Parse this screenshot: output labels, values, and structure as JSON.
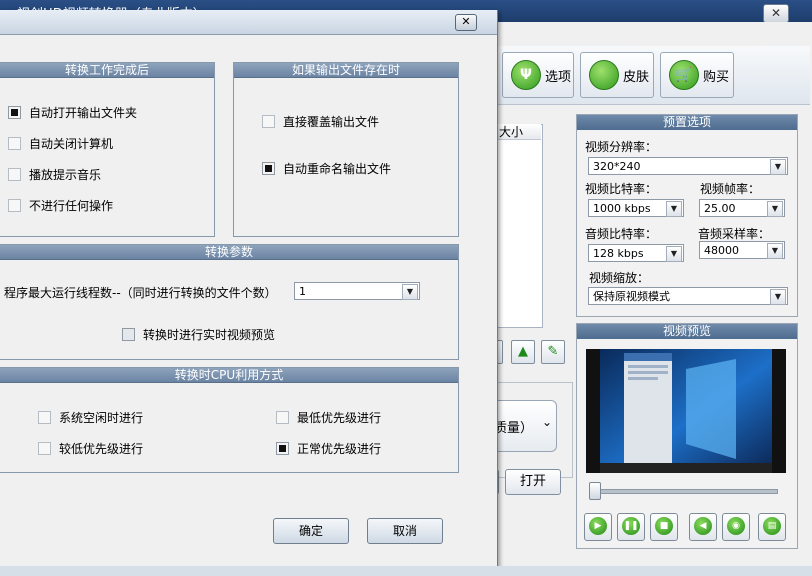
{
  "main_window": {
    "title": "—视创HD视频转换器（专业版本）"
  },
  "toolbar": {
    "options_label": "选项",
    "skin_label": "皮肤",
    "buy_label": "购买"
  },
  "file_list": {
    "size_header": "大小"
  },
  "quality": {
    "partial_text": "质量）",
    "open_label": "打开"
  },
  "preset": {
    "title": "预置选项",
    "resolution_label": "视频分辨率：",
    "resolution_value": "320*240",
    "video_bitrate_label": "视频比特率：",
    "video_bitrate_value": "1000 kbps",
    "framerate_label": "视频帧率：",
    "framerate_value": "25.00",
    "audio_bitrate_label": "音频比特率：",
    "audio_bitrate_value": "128 kbps",
    "samplerate_label": "音频采样率：",
    "samplerate_value": "48000",
    "scale_label": "视频缩放：",
    "scale_value": "保持原视频模式"
  },
  "preview": {
    "title": "视频预览",
    "seek_position": 0.0
  },
  "dialog": {
    "after_complete": {
      "title": "转换工作完成后",
      "options": [
        {
          "label": "自动打开输出文件夹",
          "checked": true
        },
        {
          "label": "自动关闭计算机",
          "checked": false
        },
        {
          "label": "播放提示音乐",
          "checked": false
        },
        {
          "label": "不进行任何操作",
          "checked": false
        }
      ]
    },
    "if_exists": {
      "title": "如果输出文件存在时",
      "options": [
        {
          "label": "直接覆盖输出文件",
          "checked": false
        },
        {
          "label": "自动重命名输出文件",
          "checked": true
        }
      ]
    },
    "params": {
      "title": "转换参数",
      "threads_label": "程序最大运行线程数--（同时进行转换的文件个数）",
      "threads_value": "1",
      "preview_label": "转换时进行实时视频预览"
    },
    "cpu": {
      "title": "转换时CPU利用方式",
      "options": [
        {
          "label": "系统空闲时进行",
          "checked": false
        },
        {
          "label": "最低优先级进行",
          "checked": false
        },
        {
          "label": "较低优先级进行",
          "checked": false
        },
        {
          "label": "正常优先级进行",
          "checked": true
        }
      ]
    },
    "ok_label": "确定",
    "cancel_label": "取消"
  }
}
